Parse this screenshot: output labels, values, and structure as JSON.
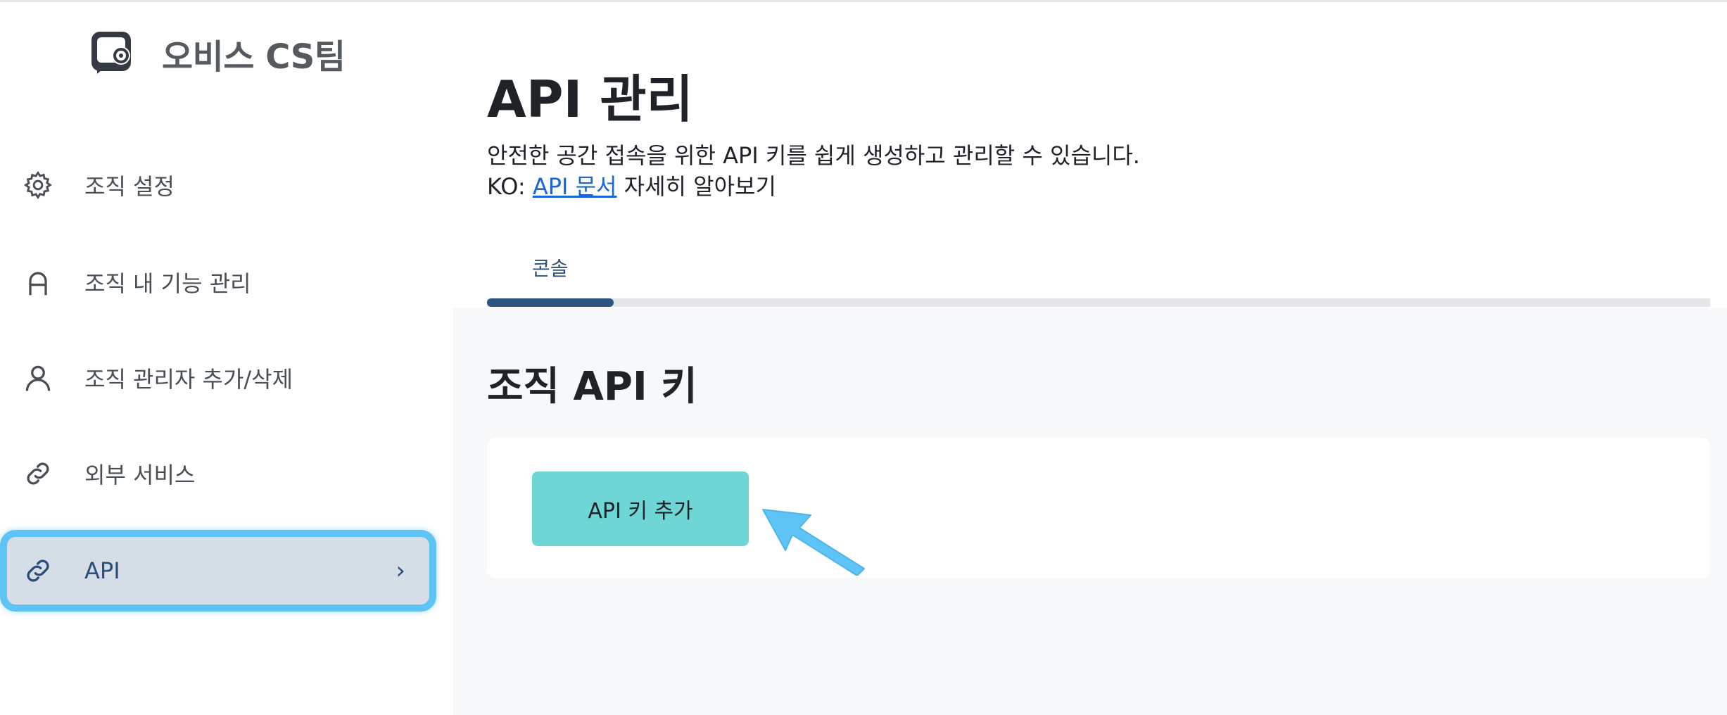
{
  "sidebar": {
    "brand": {
      "name": "오비스 CS팀",
      "logo_icon": "office-logo-icon"
    },
    "items": [
      {
        "label": "조직 설정",
        "icon": "gear-icon"
      },
      {
        "label": "조직 내 기능 관리",
        "icon": "lock-icon"
      },
      {
        "label": "조직 관리자 추가/삭제",
        "icon": "person-icon"
      },
      {
        "label": "외부 서비스",
        "icon": "link-icon"
      },
      {
        "label": "API",
        "icon": "link-icon",
        "active": true,
        "chevron": "›"
      }
    ]
  },
  "main": {
    "title": "API 관리",
    "description": "안전한 공간 접속을 위한 API 키를 쉽게 생성하고 관리할 수 있습니다.",
    "doc_prefix": "KO: ",
    "doc_link": "API 문서",
    "doc_suffix": " 자세히 알아보기",
    "tabs": [
      {
        "label": "콘솔",
        "active": true
      }
    ],
    "section_title": "조직 API 키",
    "add_button": "API 키 추가"
  },
  "colors": {
    "accent": "#2b5580",
    "active_border": "#5ec3f5",
    "button": "#6fd6d6",
    "link": "#1a66d9"
  }
}
